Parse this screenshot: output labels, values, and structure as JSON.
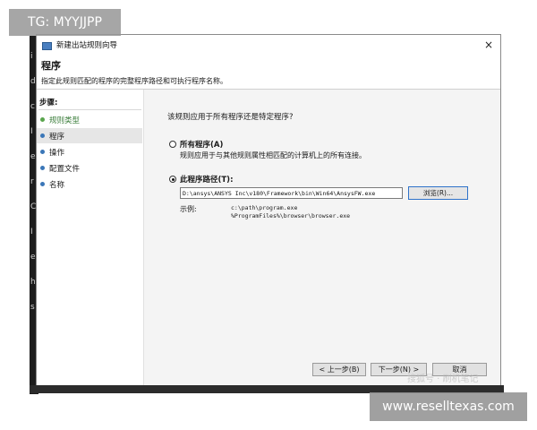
{
  "overlays": {
    "top_left_tag": "TG: MYYJJPP",
    "bottom_right_tag": "www.reselltexas.com",
    "watermark": "搜狐号 · 刷机笔记"
  },
  "background_app": {
    "fragments": [
      "i",
      "d",
      "c",
      "I",
      "e",
      "r",
      "C",
      "I",
      "e",
      "h",
      "s"
    ]
  },
  "window": {
    "title": "新建出站规则向导",
    "close_glyph": "×"
  },
  "header": {
    "title": "程序",
    "description": "指定此规则匹配的程序的完整程序路径和可执行程序名称。"
  },
  "steps": {
    "label": "步骤:",
    "items": [
      {
        "label": "规则类型",
        "state": "done"
      },
      {
        "label": "程序",
        "state": "active"
      },
      {
        "label": "操作",
        "state": "pending"
      },
      {
        "label": "配置文件",
        "state": "pending"
      },
      {
        "label": "名称",
        "state": "pending"
      }
    ]
  },
  "content": {
    "question": "该规则应用于所有程序还是特定程序?",
    "all_programs": {
      "label": "所有程序(A)",
      "description": "规则应用于与其他规则属性相匹配的计算机上的所有连接。",
      "checked": false
    },
    "this_program": {
      "label": "此程序路径(T):",
      "checked": true,
      "path_value": "D:\\ansys\\ANSYS Inc\\v180\\Framework\\bin\\Win64\\AnsysFW.exe",
      "browse_label": "浏览(R)..."
    },
    "example": {
      "label": "示例:",
      "line1": "c:\\path\\program.exe",
      "line2": "%ProgramFiles%\\browser\\browser.exe"
    }
  },
  "footer": {
    "back_label": "< 上一步(B)",
    "next_label": "下一步(N) >",
    "cancel_label": "取消"
  },
  "colors": {
    "step_dot": "#3b77b8",
    "step_dot_done": "#59a54c",
    "browse_border": "#2e72c9"
  }
}
